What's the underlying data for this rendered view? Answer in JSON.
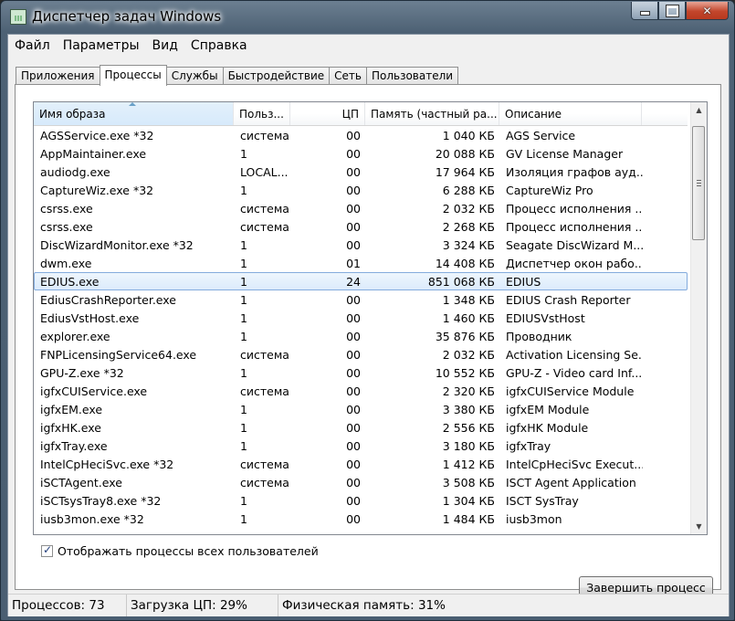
{
  "window": {
    "title": "Диспетчер задач Windows"
  },
  "menu": [
    "Файл",
    "Параметры",
    "Вид",
    "Справка"
  ],
  "tabs": [
    {
      "label": "Приложения"
    },
    {
      "label": "Процессы"
    },
    {
      "label": "Службы"
    },
    {
      "label": "Быстродействие"
    },
    {
      "label": "Сеть"
    },
    {
      "label": "Пользователи"
    }
  ],
  "active_tab": "Процессы",
  "columns": [
    "Имя образа",
    "Польз...",
    "ЦП",
    "Память (частный ра...",
    "Описание"
  ],
  "rows": [
    [
      "AGSService.exe *32",
      "система",
      "00",
      "1 040 КБ",
      "AGS Service"
    ],
    [
      "AppMaintainer.exe",
      "1",
      "00",
      "20 088 КБ",
      "GV License Manager"
    ],
    [
      "audiodg.exe",
      "LOCAL...",
      "00",
      "17 964 КБ",
      "Изоляция графов ауд..."
    ],
    [
      "CaptureWiz.exe *32",
      "1",
      "00",
      "6 288 КБ",
      "CaptureWiz Pro"
    ],
    [
      "csrss.exe",
      "система",
      "00",
      "2 032 КБ",
      "Процесс исполнения ..."
    ],
    [
      "csrss.exe",
      "система",
      "00",
      "2 268 КБ",
      "Процесс исполнения ..."
    ],
    [
      "DiscWizardMonitor.exe *32",
      "1",
      "00",
      "3 324 КБ",
      "Seagate DiscWizard M..."
    ],
    [
      "dwm.exe",
      "1",
      "01",
      "14 408 КБ",
      "Диспетчер окон рабо..."
    ],
    [
      "EDIUS.exe",
      "1",
      "24",
      "851 068 КБ",
      "EDIUS"
    ],
    [
      "EdiusCrashReporter.exe",
      "1",
      "00",
      "1 348 КБ",
      "EDIUS Crash Reporter"
    ],
    [
      "EdiusVstHost.exe",
      "1",
      "00",
      "1 460 КБ",
      "EDIUSVstHost"
    ],
    [
      "explorer.exe",
      "1",
      "00",
      "35 876 КБ",
      "Проводник"
    ],
    [
      "FNPLicensingService64.exe",
      "система",
      "00",
      "2 032 КБ",
      "Activation Licensing Se..."
    ],
    [
      "GPU-Z.exe *32",
      "1",
      "00",
      "10 552 КБ",
      "GPU-Z - Video card Inf..."
    ],
    [
      "igfxCUIService.exe",
      "система",
      "00",
      "2 320 КБ",
      "igfxCUIService Module"
    ],
    [
      "igfxEM.exe",
      "1",
      "00",
      "3 380 КБ",
      "igfxEM Module"
    ],
    [
      "igfxHK.exe",
      "1",
      "00",
      "2 556 КБ",
      "igfxHK Module"
    ],
    [
      "igfxTray.exe",
      "1",
      "00",
      "3 180 КБ",
      "igfxTray"
    ],
    [
      "IntelCpHeciSvc.exe *32",
      "система",
      "00",
      "1 412 КБ",
      "IntelCpHeciSvc Execut..."
    ],
    [
      "iSCTAgent.exe",
      "система",
      "00",
      "3 508 КБ",
      "ISCT Agent Application"
    ],
    [
      "iSCTsysTray8.exe *32",
      "1",
      "00",
      "1 304 КБ",
      "ISCT SysTray"
    ],
    [
      "iusb3mon.exe *32",
      "1",
      "00",
      "1 484 КБ",
      "iusb3mon"
    ]
  ],
  "selected_process": "EDIUS.exe",
  "show_all_users": {
    "label": "Отображать процессы всех пользователей",
    "checked": true
  },
  "end_process_label": "Завершить процесс",
  "status": {
    "processes": "Процессов: 73",
    "cpu": "Загрузка ЦП: 29%",
    "memory": "Физическая память: 31%"
  }
}
